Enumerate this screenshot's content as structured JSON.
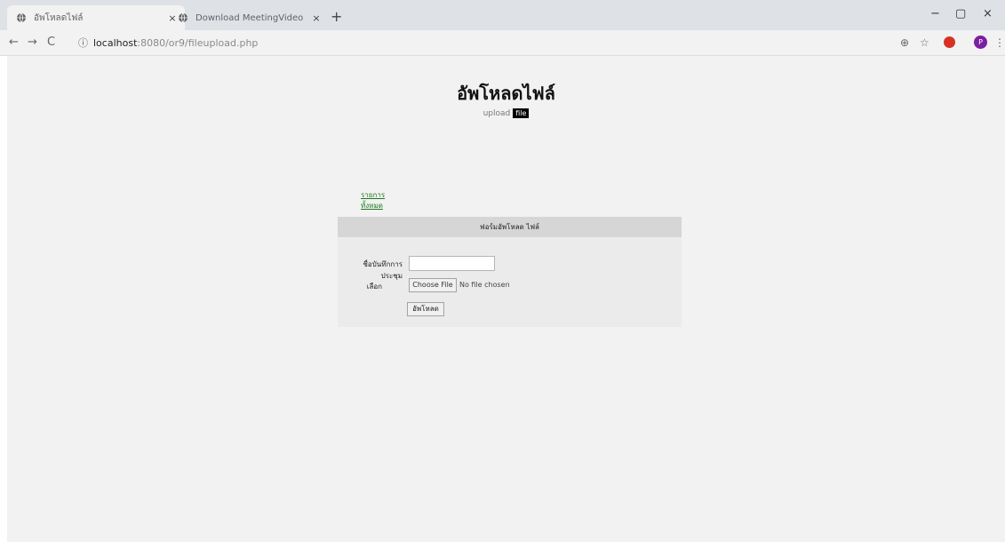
{
  "browser": {
    "tabs": [
      {
        "title": "อัพโหลดไฟล์",
        "active": true
      },
      {
        "title": "Download MeetingVideo",
        "active": false
      }
    ],
    "close_glyph": "×",
    "new_tab_glyph": "+",
    "window_controls": {
      "minimize": "−",
      "restore": "▢",
      "close": "×"
    },
    "nav": {
      "back": "←",
      "forward": "→",
      "reload": "C"
    },
    "address": {
      "info_glyph": "ⓘ",
      "host": "localhost",
      "rest": ":8080/or9/fileupload.php"
    },
    "toolbar_icons": {
      "zoom": "⊕",
      "star": "☆",
      "menu": "⋮"
    },
    "profile_initial": "P",
    "colors": {
      "tab_strip": "#dee1e6",
      "toolbar": "#f2f2f2",
      "avatar": "#7b1fa2",
      "extension": "#d93025"
    }
  },
  "page": {
    "heading": "อัพโหลดไฟล์",
    "sub_text": "upload",
    "sub_tag": "file",
    "links": [
      "รายการ",
      "ทั้งหมด"
    ],
    "form": {
      "header": "ฟอร์มอัพโหลด ไฟล์",
      "field_label": "ชื่อบันทึกการประชุม",
      "field_value": "",
      "file_label": "เลือก",
      "file_button": "Choose File",
      "file_status": "No file chosen",
      "submit_label": "อัพโหลด"
    },
    "colors": {
      "background": "#f2f2f2",
      "panel_header": "#d6d6d6",
      "panel_body": "#ebebeb",
      "link": "#1a7a1a"
    }
  }
}
